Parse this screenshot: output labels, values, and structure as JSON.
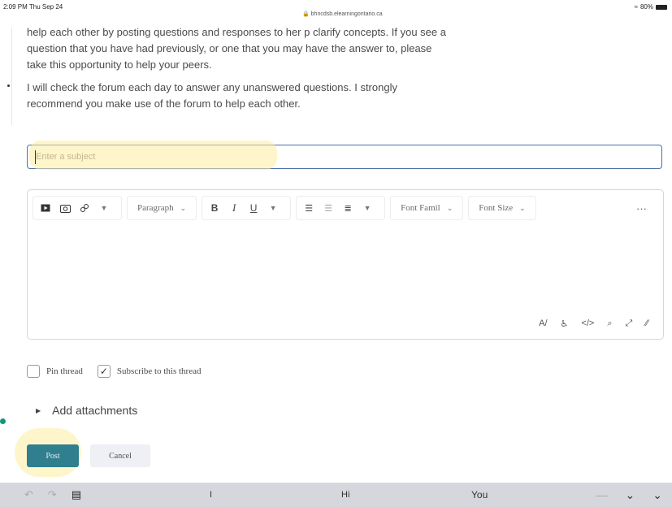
{
  "status_bar": {
    "time": "2:09 PM  Thu Sep 24",
    "url": "🔒 bhncdsb.elearningontario.ca",
    "battery": "80%"
  },
  "post_content": {
    "paragraph1": "help each other by posting questions and responses to her p clarify concepts. If you see a question that you have had previously, or one that you may have the answer to, please take this opportunity to help your peers.",
    "paragraph2": "I will check the forum each day to answer any unanswered questions. I strongly recommend you make use of the forum to help each other."
  },
  "subject_field": {
    "placeholder": "Enter a subject",
    "value": ""
  },
  "editor": {
    "paragraph_label": "Paragraph",
    "bold": "B",
    "italic": "I",
    "underline": "U",
    "font_family_label": "Font Famil",
    "font_size_label": "Font Size",
    "more": "···"
  },
  "options": {
    "pin_thread": "Pin thread",
    "subscribe": "Subscribe to this thread",
    "subscribe_checked": true,
    "pin_checked": false
  },
  "attachments": {
    "label": "Add attachments"
  },
  "actions": {
    "post": "Post",
    "cancel": "Cancel"
  },
  "keyboard_bar": {
    "suggestions": [
      "I",
      "Hi",
      "You"
    ]
  },
  "colors": {
    "post_button": "#2f7f8e",
    "subject_border": "#4b6fa8",
    "highlight": "#ffeca0"
  }
}
